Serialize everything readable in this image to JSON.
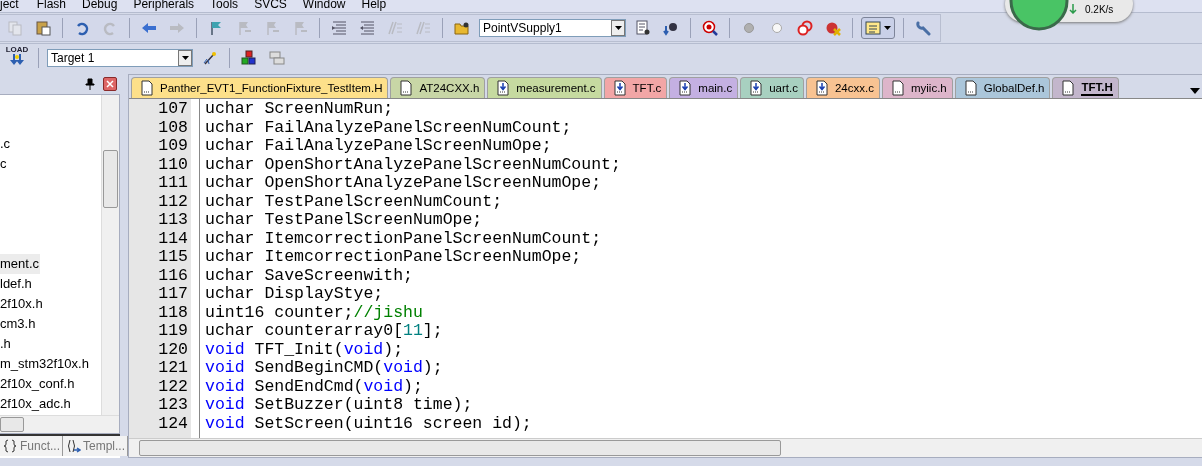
{
  "menu": [
    "ject",
    "Flash",
    "Debug",
    "Peripherals",
    "Tools",
    "SVCS",
    "Window",
    "Help"
  ],
  "network_widget": {
    "speed": "0.2K/s"
  },
  "toolbar_1": [
    {
      "kind": "copy",
      "disabled": true
    },
    {
      "kind": "paste",
      "disabled": false
    },
    {
      "kind": "separator"
    },
    {
      "kind": "undo",
      "disabled": false
    },
    {
      "kind": "redo",
      "disabled": true
    },
    {
      "kind": "separator"
    },
    {
      "kind": "back",
      "disabled": false
    },
    {
      "kind": "forward",
      "disabled": true
    },
    {
      "kind": "separator"
    },
    {
      "kind": "bookmark",
      "disabled": false
    },
    {
      "kind": "bookmark-prev",
      "disabled": true
    },
    {
      "kind": "bookmark-next",
      "disabled": true
    },
    {
      "kind": "bookmark-clear",
      "disabled": true
    },
    {
      "kind": "separator"
    },
    {
      "kind": "indent",
      "disabled": false
    },
    {
      "kind": "unindent",
      "disabled": false
    },
    {
      "kind": "comment",
      "disabled": true
    },
    {
      "kind": "uncomment",
      "disabled": true
    },
    {
      "kind": "separator"
    },
    {
      "kind": "folder",
      "disabled": false
    },
    {
      "kind": "combo",
      "value": "PointVSupply1"
    },
    {
      "kind": "find-files",
      "disabled": false
    },
    {
      "kind": "debug-find",
      "disabled": false
    },
    {
      "kind": "separator"
    },
    {
      "kind": "debug",
      "disabled": false
    },
    {
      "kind": "separator"
    },
    {
      "kind": "dot-grey",
      "disabled": false
    },
    {
      "kind": "dot-white",
      "disabled": false
    },
    {
      "kind": "rings",
      "disabled": false
    },
    {
      "kind": "kill",
      "disabled": false
    },
    {
      "kind": "separator"
    },
    {
      "kind": "window-menu"
    },
    {
      "kind": "separator"
    },
    {
      "kind": "wrench",
      "disabled": false
    }
  ],
  "toolbar_2": [
    {
      "kind": "load",
      "label": "LOAD"
    },
    {
      "kind": "separator"
    },
    {
      "kind": "combo",
      "value": "Target 1"
    },
    {
      "kind": "wand"
    },
    {
      "kind": "separator"
    },
    {
      "kind": "blocks"
    },
    {
      "kind": "stack"
    }
  ],
  "project_panel": {
    "items_top": [
      {
        "label": ".c",
        "selected": false
      },
      {
        "label": "c",
        "selected": false
      }
    ],
    "items": [
      {
        "label": "ment.c",
        "selected": true
      },
      {
        "label": "ldef.h",
        "selected": false
      },
      {
        "label": "2f10x.h",
        "selected": false
      },
      {
        "label": "cm3.h",
        "selected": false
      },
      {
        "label": ".h",
        "selected": false
      },
      {
        "label": "m_stm32f10x.h",
        "selected": false
      },
      {
        "label": "2f10x_conf.h",
        "selected": false
      },
      {
        "label": "2f10x_adc.h",
        "selected": false
      }
    ],
    "bottom_tabs": [
      {
        "kind": "functions",
        "label": "Funct...",
        "selected": false
      },
      {
        "kind": "templates",
        "label": "Templ...",
        "selected": false
      }
    ]
  },
  "editor_tabs": [
    {
      "label": "Panther_EVT1_FunctionFixture_TestItem.H",
      "kind": "header",
      "color": "#fde08a",
      "selected": false
    },
    {
      "label": "AT24CXX.h",
      "kind": "header",
      "color": "#c8d6a6",
      "selected": false
    },
    {
      "label": "measurement.c",
      "kind": "source",
      "color": "#c6daa0",
      "selected": false
    },
    {
      "label": "TFT.c",
      "kind": "source",
      "color": "#f2a6a6",
      "selected": false
    },
    {
      "label": "main.c",
      "kind": "source",
      "color": "#c4b0e2",
      "selected": false
    },
    {
      "label": "uart.c",
      "kind": "source",
      "color": "#a8d0c0",
      "selected": false
    },
    {
      "label": "24cxx.c",
      "kind": "source",
      "color": "#f8c392",
      "selected": false
    },
    {
      "label": "myiic.h",
      "kind": "header",
      "color": "#ddb5ca",
      "selected": false
    },
    {
      "label": "GlobalDef.h",
      "kind": "header",
      "color": "#abc6da",
      "selected": false
    },
    {
      "label": "TFT.H",
      "kind": "header",
      "color": "#c3b6cc",
      "selected": true
    }
  ],
  "code_lines": [
    {
      "number": "107",
      "tokens": [
        {
          "kind": "plain",
          "text": "uchar ScreenNumRun;"
        }
      ]
    },
    {
      "number": "108",
      "tokens": [
        {
          "kind": "plain",
          "text": "uchar FailAnalyzePanelScreenNumCount;"
        }
      ]
    },
    {
      "number": "109",
      "tokens": [
        {
          "kind": "plain",
          "text": "uchar FailAnalyzePanelScreenNumOpe;"
        }
      ]
    },
    {
      "number": "110",
      "tokens": [
        {
          "kind": "plain",
          "text": "uchar OpenShortAnalyzePanelScreenNumCount;"
        }
      ]
    },
    {
      "number": "111",
      "tokens": [
        {
          "kind": "plain",
          "text": "uchar OpenShortAnalyzePanelScreenNumOpe;"
        }
      ]
    },
    {
      "number": "112",
      "tokens": [
        {
          "kind": "plain",
          "text": "uchar TestPanelScreenNumCount;"
        }
      ]
    },
    {
      "number": "113",
      "tokens": [
        {
          "kind": "plain",
          "text": "uchar TestPanelScreenNumOpe;"
        }
      ]
    },
    {
      "number": "114",
      "tokens": [
        {
          "kind": "plain",
          "text": "uchar ItemcorrectionPanelScreenNumCount;"
        }
      ]
    },
    {
      "number": "115",
      "tokens": [
        {
          "kind": "plain",
          "text": "uchar ItemcorrectionPanelScreenNumOpe;"
        }
      ]
    },
    {
      "number": "116",
      "tokens": [
        {
          "kind": "plain",
          "text": "uchar SaveScreenwith;"
        }
      ]
    },
    {
      "number": "117",
      "tokens": [
        {
          "kind": "plain",
          "text": "uchar DisplayStye;"
        }
      ]
    },
    {
      "number": "118",
      "tokens": [
        {
          "kind": "plain",
          "text": "uint16 counter;"
        },
        {
          "kind": "comment",
          "text": "//jishu"
        }
      ]
    },
    {
      "number": "119",
      "tokens": [
        {
          "kind": "plain",
          "text": "uchar counterarray0["
        },
        {
          "kind": "number",
          "text": "11"
        },
        {
          "kind": "plain",
          "text": "];"
        }
      ]
    },
    {
      "number": "120",
      "tokens": [
        {
          "kind": "keyword",
          "text": "void"
        },
        {
          "kind": "plain",
          "text": " TFT_Init("
        },
        {
          "kind": "keyword",
          "text": "void"
        },
        {
          "kind": "plain",
          "text": ");"
        }
      ]
    },
    {
      "number": "121",
      "tokens": [
        {
          "kind": "keyword",
          "text": "void"
        },
        {
          "kind": "plain",
          "text": " SendBeginCMD("
        },
        {
          "kind": "keyword",
          "text": "void"
        },
        {
          "kind": "plain",
          "text": ");"
        }
      ]
    },
    {
      "number": "122",
      "tokens": [
        {
          "kind": "keyword",
          "text": "void"
        },
        {
          "kind": "plain",
          "text": " SendEndCmd("
        },
        {
          "kind": "keyword",
          "text": "void"
        },
        {
          "kind": "plain",
          "text": ");"
        }
      ]
    },
    {
      "number": "123",
      "tokens": [
        {
          "kind": "keyword",
          "text": "void"
        },
        {
          "kind": "plain",
          "text": " SetBuzzer(uint8 time);"
        }
      ]
    },
    {
      "number": "124",
      "tokens": [
        {
          "kind": "keyword",
          "text": "void"
        },
        {
          "kind": "plain",
          "text": " SetScreen(uint16 screen id);"
        }
      ]
    }
  ]
}
